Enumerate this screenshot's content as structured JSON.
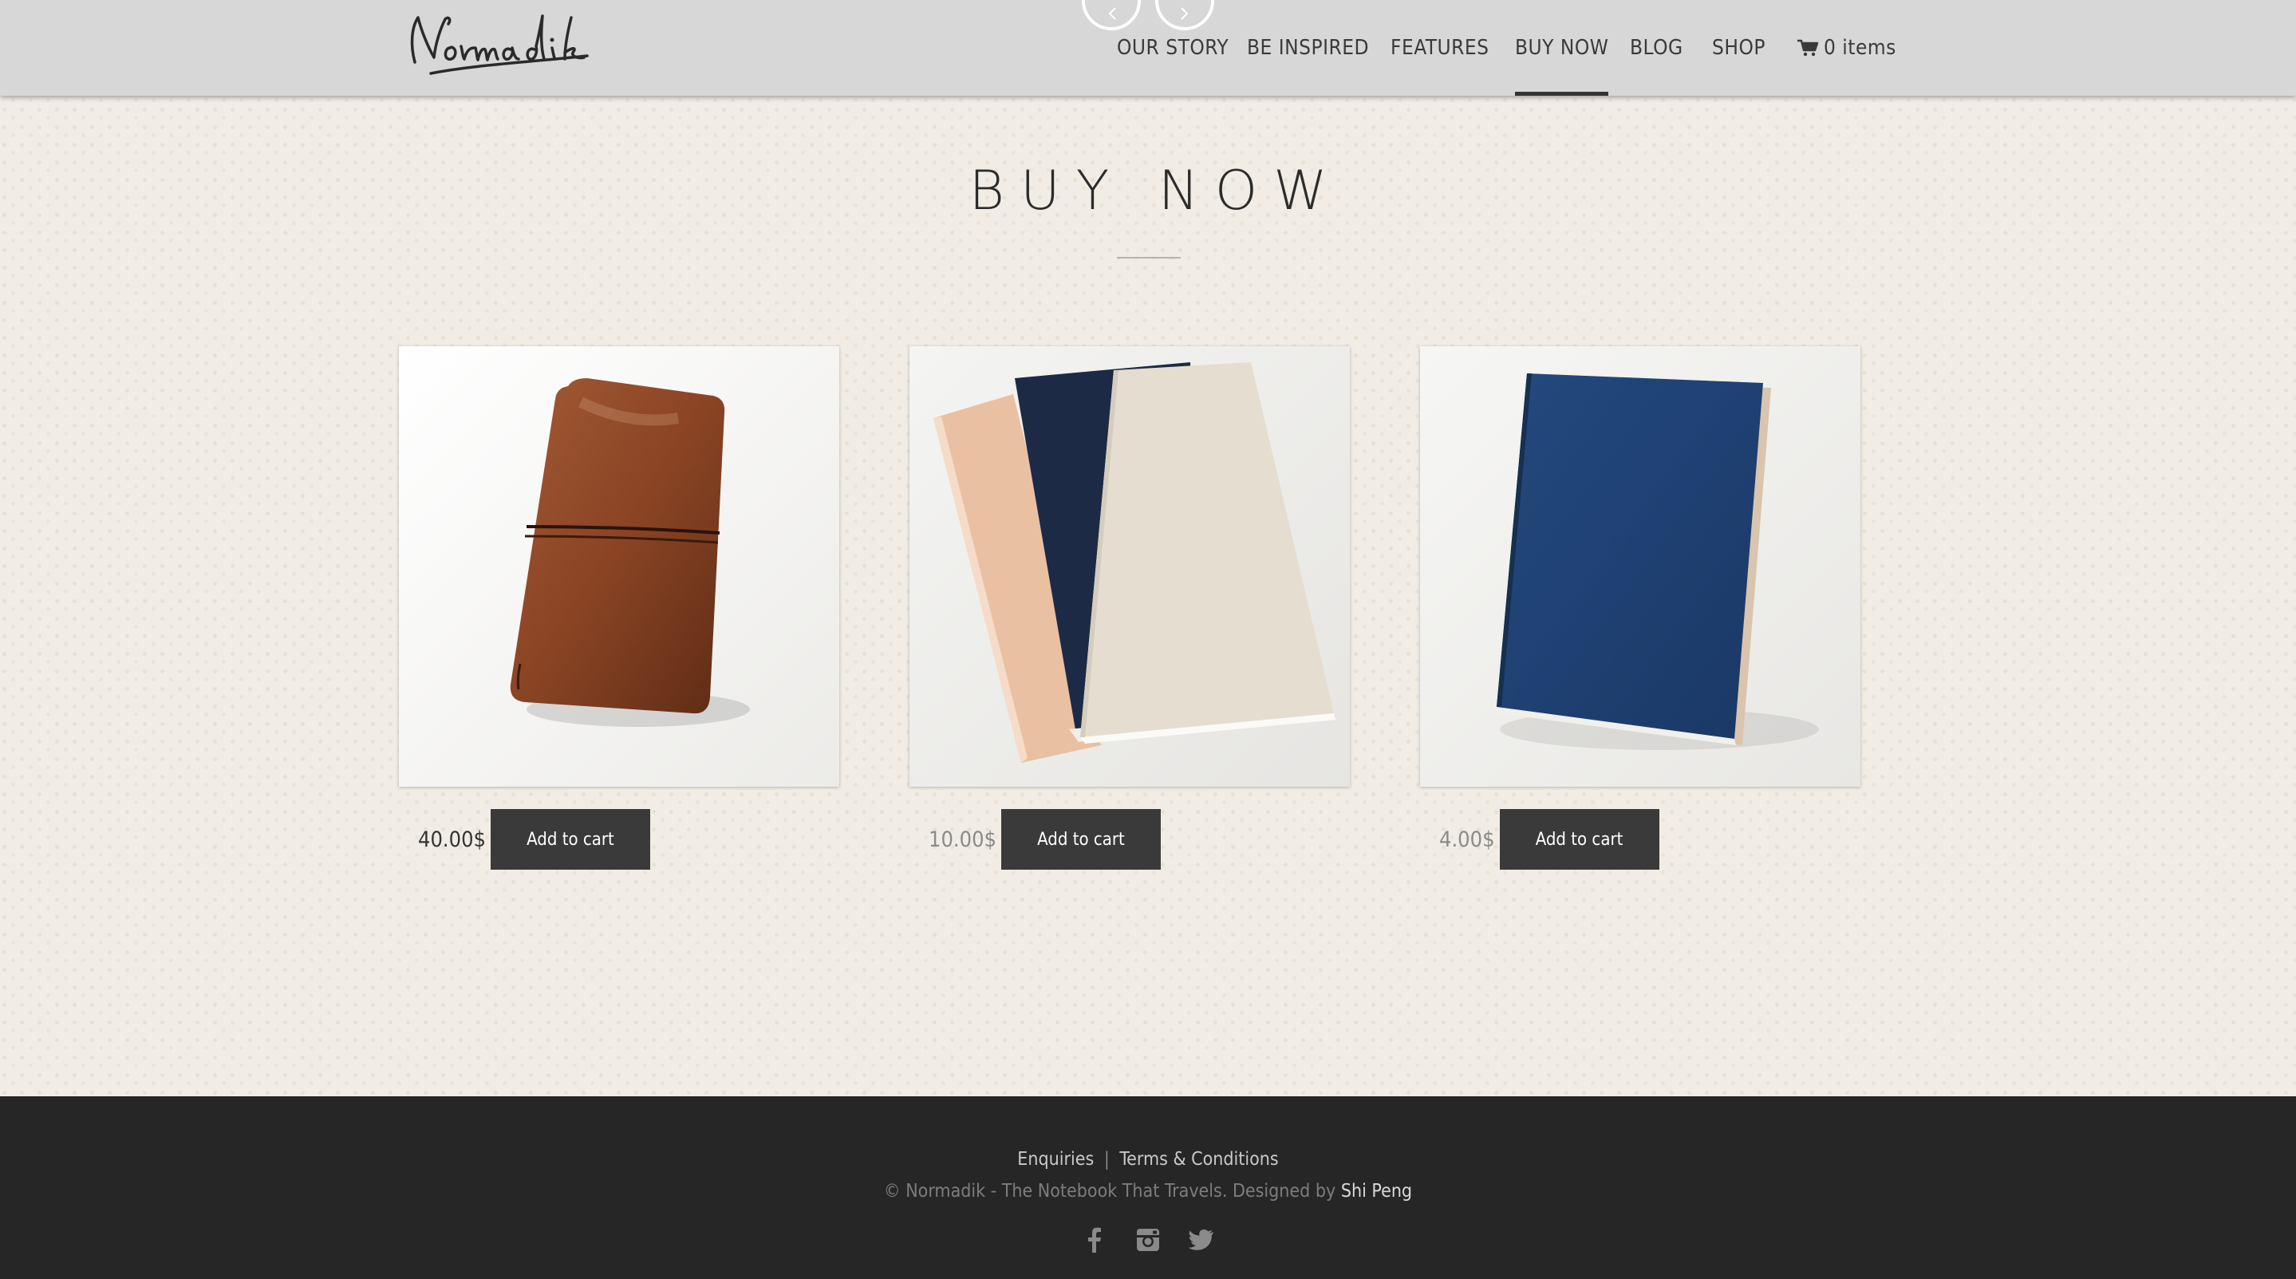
{
  "header": {
    "logo_text": "Normadik",
    "nav": [
      {
        "label": "OUR STORY"
      },
      {
        "label": "BE INSPIRED"
      },
      {
        "label": "FEATURES"
      },
      {
        "label": "BUY NOW",
        "active": true
      },
      {
        "label": "BLOG"
      },
      {
        "label": "SHOP"
      }
    ],
    "cart_label": "0 items"
  },
  "main": {
    "title": "BUY NOW",
    "products": [
      {
        "price": "40.00$",
        "button": "Add to cart",
        "image": "brown-leather-notebook-cover"
      },
      {
        "price": "10.00$",
        "button": "Add to cart",
        "image": "three-notebook-inserts"
      },
      {
        "price": "4.00$",
        "button": "Add to cart",
        "image": "blue-notebook-insert"
      }
    ]
  },
  "footer": {
    "enquiries": "Enquiries",
    "separator": "|",
    "terms": "Terms & Conditions",
    "copyright": "© Normadik - The Notebook That Travels. Designed by",
    "designer": "Shi Peng",
    "social": [
      "facebook-icon",
      "instagram-icon",
      "twitter-icon"
    ]
  },
  "colors": {
    "header_bg": "#d7d7d7",
    "page_bg": "#f1ede6",
    "button_bg": "#3a3a3a",
    "footer_bg": "#262626"
  }
}
